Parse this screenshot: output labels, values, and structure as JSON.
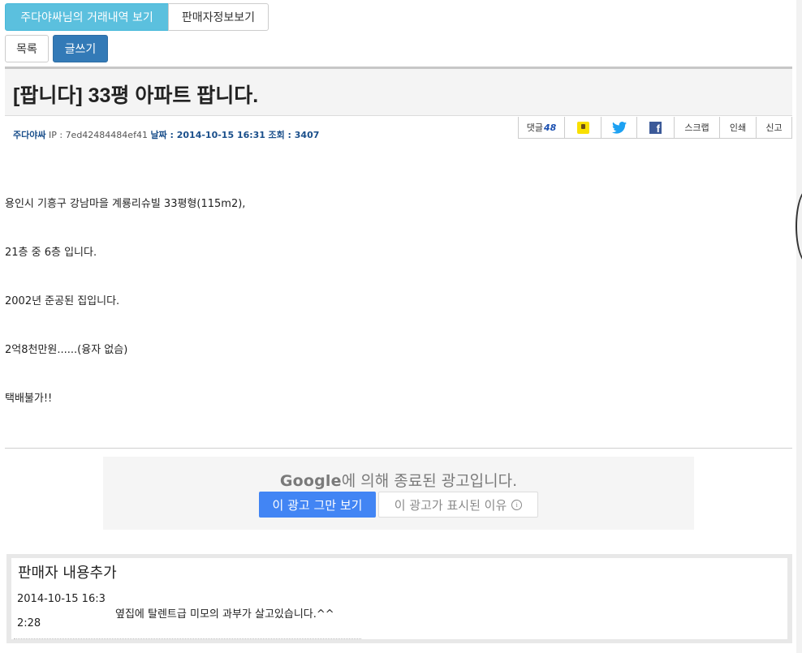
{
  "tabs": {
    "history_label": "주다야싸님의 거래내역 보기",
    "seller_info_label": "판매자정보보기"
  },
  "actions": {
    "list_label": "목록",
    "write_label": "글쓰기"
  },
  "post": {
    "title": "[팝니다] 33평 아파트 팝니다.",
    "author": "주다야싸",
    "ip_label": "IP : ",
    "ip": "7ed42484484ef41",
    "date_label": "날짜 : ",
    "date": "2014-10-15 16:31",
    "views_label": "조회 : ",
    "views": "3407",
    "body": [
      "용인시 기흥구 강남마을 계룡리슈빌 33평형(115m2),",
      "21층 중 6층 입니다.",
      "2002년 준공된 집입니다.",
      "2억8천만원......(융자 없슴)",
      "택배불가!!"
    ]
  },
  "share": {
    "comments_label": "댓글",
    "comments_count": "48",
    "kakao_icon": "kakaostory-icon",
    "twitter_icon": "twitter-icon",
    "facebook_icon": "facebook-icon",
    "scrap_label": "스크랩",
    "print_label": "인쇄",
    "report_label": "신고"
  },
  "ad": {
    "brand": "Google",
    "closed_text": "에 의해 종료된 광고입니다.",
    "stop_label": "이 광고 그만 보기",
    "why_label": "이 광고가 표시된 이유",
    "info_icon": "info-icon"
  },
  "seller_addition": {
    "title": "판매자 내용추가",
    "date_line1": "2014-10-15 16:3",
    "date_line2": "2:28",
    "message": "옆집에 탈렌트급 미모의 과부가 살고있습니다.^^"
  },
  "colors": {
    "info": "#5bc0de",
    "primary": "#337ab7",
    "ad_blue": "#4285f4",
    "meta_blue": "#1a4f8b",
    "twitter": "#1da1f2",
    "facebook": "#3b5998",
    "kakao": "#f9e000"
  }
}
